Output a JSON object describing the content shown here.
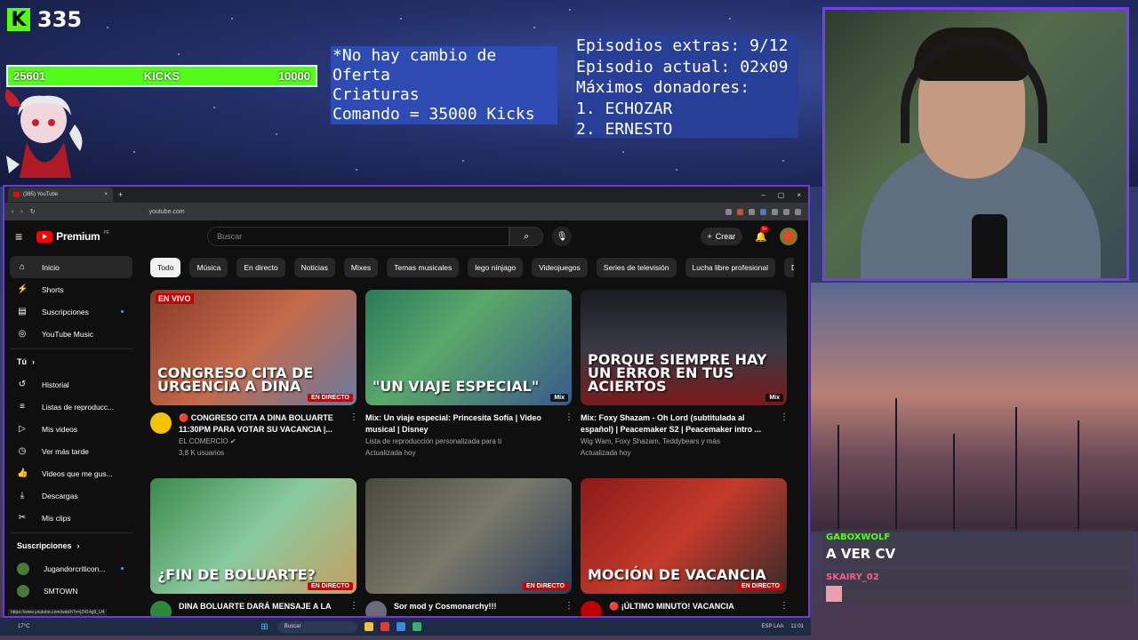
{
  "overlay": {
    "kick_count": "335",
    "kick_logo_letter": "K",
    "bar_left": "25601",
    "bar_label": "KICKS",
    "bar_right": "10000",
    "bar_progress": 1.0,
    "note_lines": [
      "*No hay cambio de",
      "Oferta",
      "Criaturas",
      "Comando = 35000 Kicks"
    ],
    "info_lines": [
      "Episodios extras: 9/12",
      "Episodio actual: 02x09",
      "Máximos donadores:",
      "1. ECHOZAR",
      "2. ERNESTO"
    ],
    "accent_color": "#53fc18",
    "frame_color": "#7a3cf0"
  },
  "chat": [
    {
      "user": "GABOXWOLF",
      "text": "A VER CV",
      "user_color": "#53fc18"
    },
    {
      "user": "SKAIRY_02",
      "text": "",
      "user_color": "#ff5a8a"
    }
  ],
  "browser": {
    "tab_title": "(385) YouTube",
    "tab_close": "×",
    "new_tab": "+",
    "window_controls": [
      "–",
      "▢",
      "×"
    ],
    "url": "youtube.com",
    "status_url": "https://www.youtube.com/watch?v=jZ414g9_U4"
  },
  "youtube": {
    "brand": "Premium",
    "region": "PE",
    "search_placeholder": "Buscar",
    "create_label": "Crear",
    "notifications": "9+",
    "sidebar": {
      "items": [
        {
          "label": "Inicio",
          "icon": "home-icon",
          "glyph": "⌂",
          "active": true
        },
        {
          "label": "Shorts",
          "icon": "shorts-icon",
          "glyph": "⚡"
        },
        {
          "label": "Suscripciones",
          "icon": "subscriptions-icon",
          "glyph": "▤",
          "dot": true
        },
        {
          "label": "YouTube Music",
          "icon": "music-icon",
          "glyph": "◎"
        }
      ],
      "you_section": "Tú",
      "you_items": [
        {
          "label": "Historial",
          "icon": "history-icon",
          "glyph": "↺"
        },
        {
          "label": "Listas de reproducc...",
          "icon": "playlists-icon",
          "glyph": "≡"
        },
        {
          "label": "Mis videos",
          "icon": "my-videos-icon",
          "glyph": "▷"
        },
        {
          "label": "Ver más tarde",
          "icon": "watch-later-icon",
          "glyph": "◷"
        },
        {
          "label": "Videos que me gus...",
          "icon": "liked-icon",
          "glyph": "👍"
        },
        {
          "label": "Descargas",
          "icon": "downloads-icon",
          "glyph": "⤓"
        },
        {
          "label": "Mis clips",
          "icon": "clips-icon",
          "glyph": "✂"
        }
      ],
      "subs_section": "Suscripciones",
      "subs": [
        {
          "label": "Jugandorcriticon...",
          "dot": true
        },
        {
          "label": "SMTOWN"
        }
      ]
    },
    "chips": [
      "Todo",
      "Música",
      "En directo",
      "Noticias",
      "Mixes",
      "Temas musicales",
      "lego ninjago",
      "Videojuegos",
      "Series de televisión",
      "Lucha libre profesional",
      "Da"
    ],
    "videos": [
      {
        "title": "🔴 CONGRESO CITA A DINA BOLUARTE 11:30PM PARA VOTAR SU VACANCIA |...",
        "channel": "EL COMERCIO ✔",
        "stats": "3,8 K usuarios",
        "thumb_text": "CONGRESO CITA DE URGENCIA A DINA",
        "live_tag": "EN VIVO",
        "badge": "EN DIRECTO",
        "avatar_color": "#f5c400",
        "thumb_bg": "linear-gradient(135deg,#8a3a2a 0%,#c46a4a 50%,#6a7aa0 100%)"
      },
      {
        "title": "Mix: Un viaje especial: Princesita Sofía | Video musical | Disney",
        "channel": "Lista de reproducción personalizada para ti",
        "stats": "Actualizada hoy",
        "thumb_text": "\"UN VIAJE ESPECIAL\"",
        "mix": "Mix",
        "thumb_bg": "linear-gradient(135deg,#2a7a5a 0%,#5aa86a 40%,#3a5a8a 100%)"
      },
      {
        "title": "Mix: Foxy Shazam - Oh Lord (subtitulada al español) | Peacemaker S2 | Peacemaker intro ...",
        "channel": "Wig Wam, Foxy Shazam, Teddybears y más",
        "stats": "Actualizada hoy",
        "thumb_text": "PORQUE SIEMPRE HAY UN ERROR EN TUS ACIERTOS",
        "mix": "Mix",
        "thumb_bg": "linear-gradient(180deg,#1a1a20 0%,#3a3a44 50%,#7a1a1a 100%)"
      },
      {
        "title": "DINA BOLUARTE DARÁ MENSAJE A LA",
        "channel": "",
        "stats": "",
        "thumb_text": "¿FIN DE BOLUARTE?",
        "badge": "EN DIRECTO",
        "avatar_color": "#2a8a3a",
        "thumb_bg": "linear-gradient(135deg,#3a8a4a 0%,#8acaa0 50%,#c4a060 100%)"
      },
      {
        "title": "Sor mod y Cosmonarchy!!!",
        "channel": "",
        "stats": "",
        "thumb_text": "",
        "badge": "EN DIRECTO",
        "avatar_color": "#6a6a7a",
        "thumb_bg": "linear-gradient(135deg,#4a4a3a 0%,#7a7a6a 50%,#2a3a5a 100%)"
      },
      {
        "title": "🔴 ¡ÚLTIMO MINUTO! VACANCIA",
        "channel": "",
        "stats": "",
        "thumb_text": "MOCIÓN DE VACANCIA",
        "badge": "EN DIRECTO",
        "avatar_color": "#c00000",
        "thumb_bg": "linear-gradient(135deg,#8a1a1a 0%,#c43a2a 50%,#3a2a2a 100%)"
      }
    ]
  },
  "taskbar": {
    "weather": "17°C",
    "search": "Buscar",
    "tray_lang": "ESP LAA",
    "clock": "11:01"
  }
}
